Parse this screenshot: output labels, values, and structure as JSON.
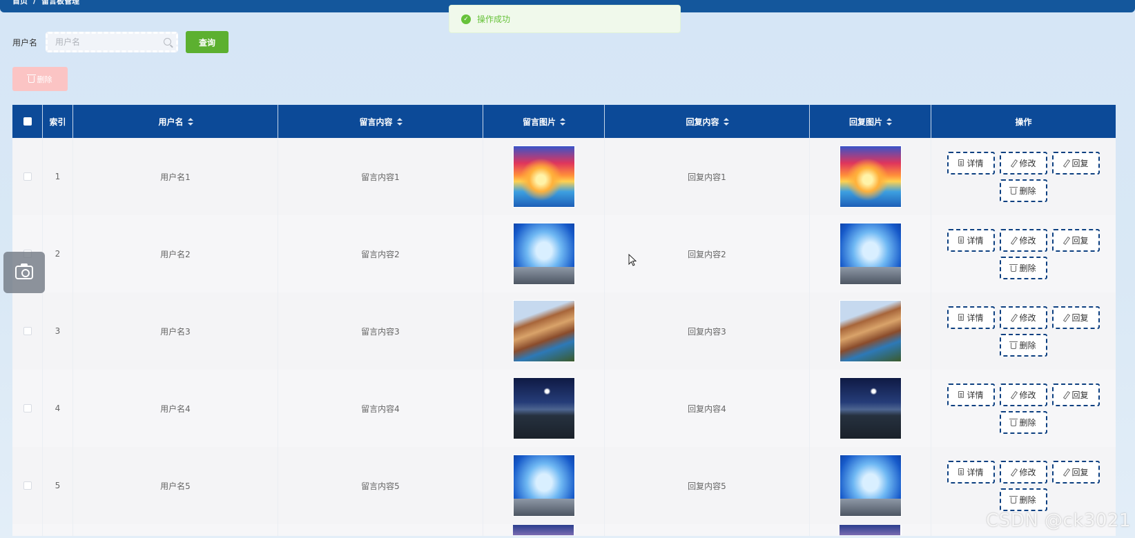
{
  "breadcrumb": {
    "home": "首页",
    "separator": "/",
    "current": "留言板管理"
  },
  "toast": {
    "message": "操作成功"
  },
  "search": {
    "label": "用户名",
    "placeholder": "用户名",
    "value": "",
    "query_label": "查询"
  },
  "batch_delete_label": "删除",
  "table": {
    "headers": {
      "index": "索引",
      "username": "用户名",
      "message": "留言内容",
      "message_image": "留言图片",
      "reply": "回复内容",
      "reply_image": "回复图片",
      "actions": "操作"
    },
    "action_labels": {
      "detail": "详情",
      "edit": "修改",
      "reply": "回复",
      "delete": "删除"
    },
    "rows": [
      {
        "index": "1",
        "username": "用户名1",
        "message": "留言内容1",
        "reply": "回复内容1",
        "image": "sunset-dolphin-image"
      },
      {
        "index": "2",
        "username": "用户名2",
        "message": "留言内容2",
        "reply": "回复内容2",
        "image": "blue-sky-person-image"
      },
      {
        "index": "3",
        "username": "用户名3",
        "message": "留言内容3",
        "reply": "回复内容3",
        "image": "cliff-village-image"
      },
      {
        "index": "4",
        "username": "用户名4",
        "message": "留言内容4",
        "reply": "回复内容4",
        "image": "night-landscape-image"
      },
      {
        "index": "5",
        "username": "用户名5",
        "message": "留言内容5",
        "reply": "回复内容5",
        "image": "blue-sky-person-image"
      }
    ]
  },
  "watermark": "CSDN @ck3021",
  "colors": {
    "header": "#0c4a98",
    "topbar": "#14579c",
    "query": "#5cb030",
    "success": "#67c23a",
    "danger_disabled": "#fbc4c4"
  }
}
